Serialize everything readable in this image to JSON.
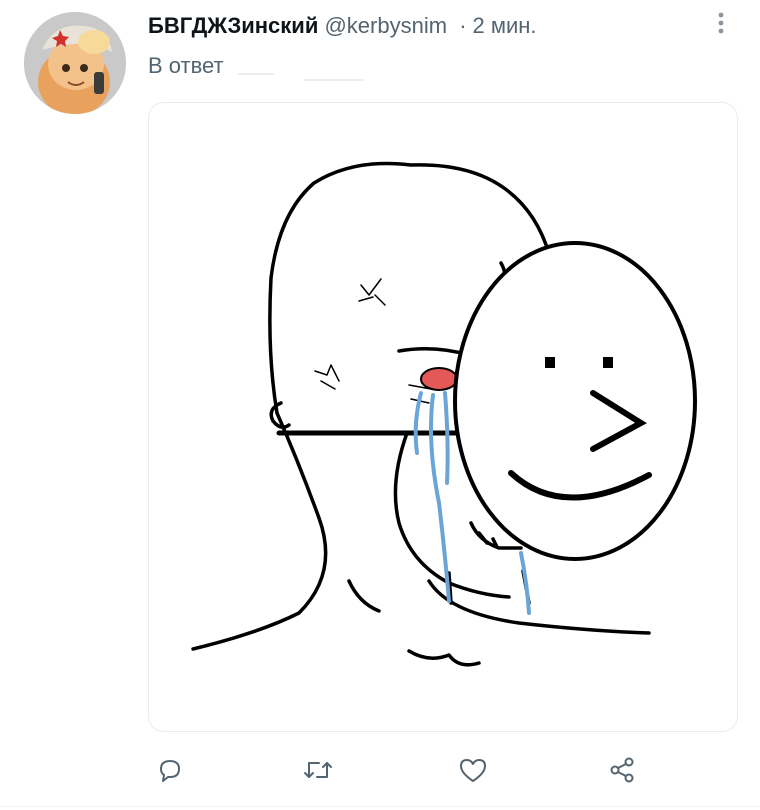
{
  "tweet": {
    "author_name": "БВГДЖЗинский",
    "author_handle": "@kerbysnim",
    "separator": "·",
    "time": "2 мин.",
    "reply_label": "В ответ"
  },
  "icons": {
    "more": "more-vertical-icon",
    "reply": "comment-icon",
    "retweet": "retweet-icon",
    "like": "heart-icon",
    "share": "share-icon"
  },
  "colors": {
    "text": "#0f1419",
    "muted": "#536471",
    "border": "#e6ecf0",
    "tears": "#6aa5d8",
    "eye_red": "#e45858"
  }
}
